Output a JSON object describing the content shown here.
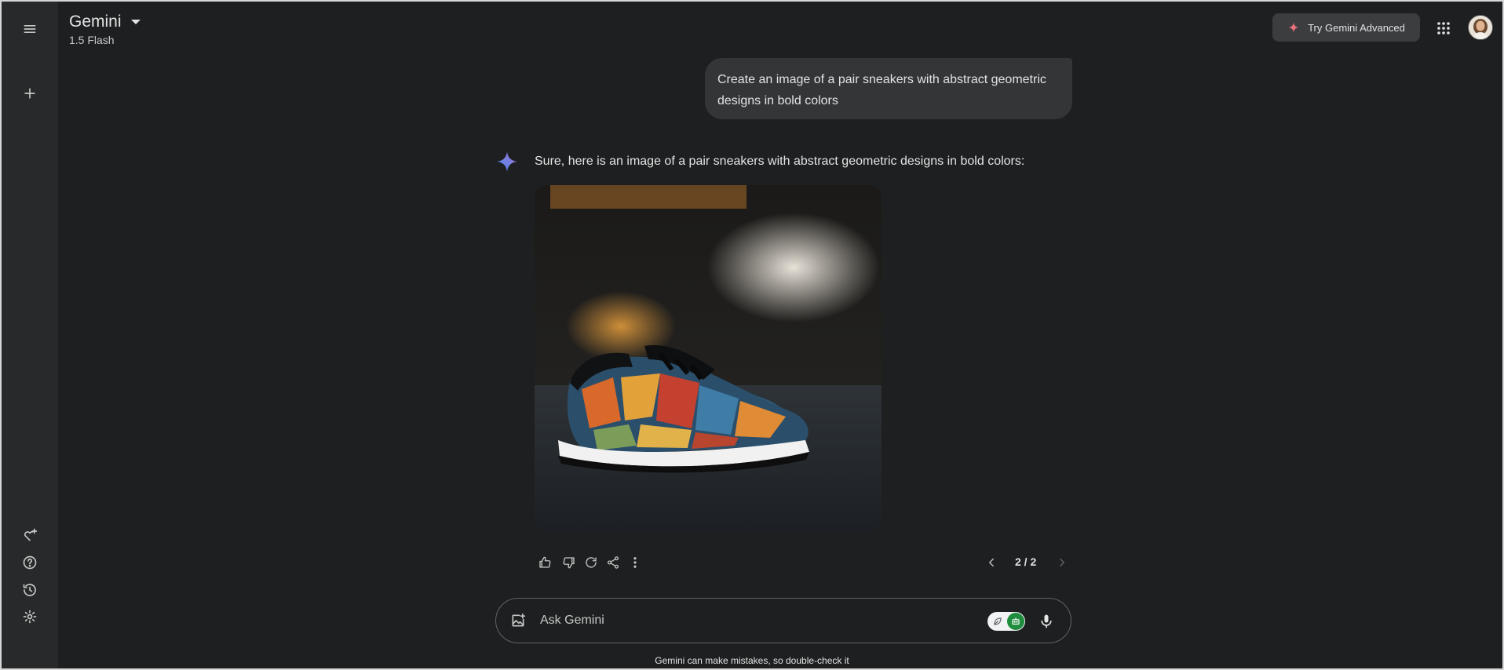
{
  "header": {
    "title": "Gemini",
    "model": "1.5 Flash",
    "try_advanced_label": "Try Gemini Advanced"
  },
  "sidebar": {
    "top_items": [
      "menu-icon",
      "new-chat-icon"
    ],
    "bottom_items": [
      "gem-manager-icon",
      "help-icon",
      "activity-icon",
      "settings-icon"
    ]
  },
  "conversation": {
    "user_prompt": "Create an image of a pair sneakers with abstract geometric designs in bold colors",
    "reply_text": "Sure, here is an image of a pair sneakers with abstract geometric designs in bold colors:",
    "pager": "2 / 2"
  },
  "input": {
    "placeholder": "Ask Gemini"
  },
  "footer": {
    "disclaimer": "Gemini can make mistakes, so double-check it"
  },
  "colors": {
    "background": "#1e1f20",
    "sidebar": "#28292a",
    "user_bubble": "#333537",
    "spark_blue": "#4c8df6",
    "advanced_spark": "#e8717a",
    "toggle_green": "#1e8e3e"
  }
}
